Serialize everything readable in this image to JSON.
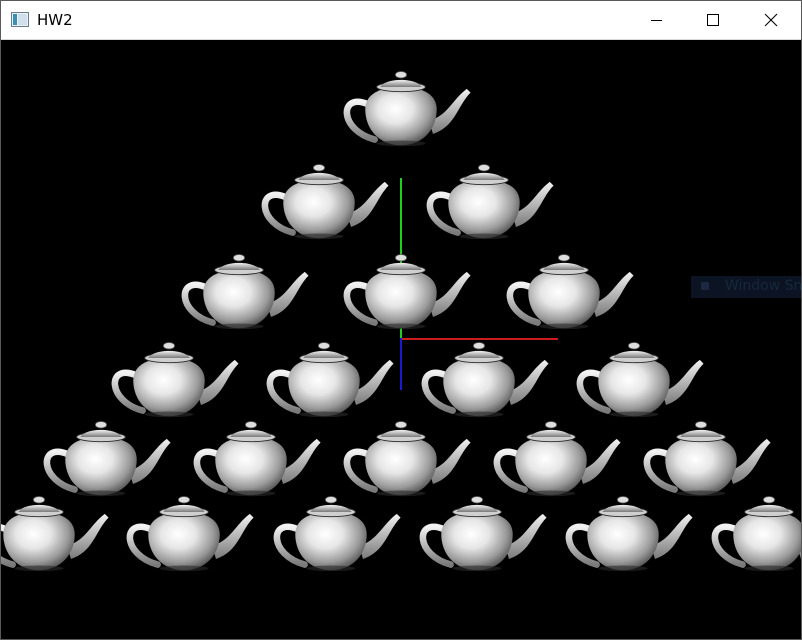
{
  "window": {
    "title": "HW2",
    "icon": "app-window-icon",
    "controls": [
      "minimize-icon",
      "maximize-icon",
      "close-icon"
    ]
  },
  "scene": {
    "background_color": "#000000",
    "object": "teapot",
    "rows": [
      1,
      2,
      3,
      4,
      5,
      6
    ],
    "axis_colors": {
      "x": "#cc1d1d",
      "y": "#1fce1f",
      "z": "#1a1ad2"
    }
  },
  "overlay": {
    "label": "Window Snip"
  }
}
